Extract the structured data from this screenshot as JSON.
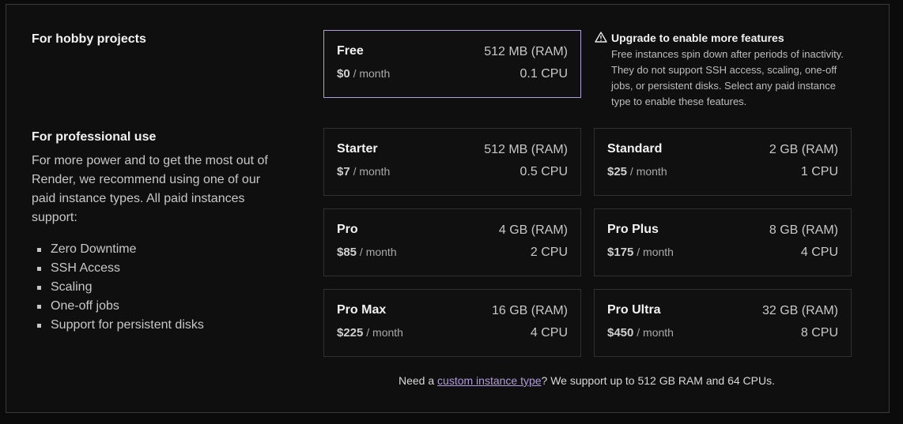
{
  "hobby": {
    "title": "For hobby projects"
  },
  "professional": {
    "title": "For professional use",
    "description": "For more power and to get the most out of Render, we recommend using one of our paid instance types. All paid instances support:",
    "features": [
      "Zero Downtime",
      "SSH Access",
      "Scaling",
      "One-off jobs",
      "Support for persistent disks"
    ]
  },
  "warning": {
    "icon": "warning-triangle-icon",
    "title": "Upgrade to enable more features",
    "body": "Free instances spin down after periods of inactivity. They do not support SSH access, scaling, one-off jobs, or persistent disks. Select any paid instance type to enable these features."
  },
  "instances": {
    "free": {
      "name": "Free",
      "amount": "$0",
      "period": "/ month",
      "ram": "512 MB (RAM)",
      "cpu": "0.1 CPU",
      "selected": true
    },
    "starter": {
      "name": "Starter",
      "amount": "$7",
      "period": "/ month",
      "ram": "512 MB (RAM)",
      "cpu": "0.5 CPU"
    },
    "standard": {
      "name": "Standard",
      "amount": "$25",
      "period": "/ month",
      "ram": "2 GB (RAM)",
      "cpu": "1 CPU"
    },
    "pro": {
      "name": "Pro",
      "amount": "$85",
      "period": "/ month",
      "ram": "4 GB (RAM)",
      "cpu": "2 CPU"
    },
    "pro_plus": {
      "name": "Pro Plus",
      "amount": "$175",
      "period": "/ month",
      "ram": "8 GB (RAM)",
      "cpu": "4 CPU"
    },
    "pro_max": {
      "name": "Pro Max",
      "amount": "$225",
      "period": "/ month",
      "ram": "16 GB (RAM)",
      "cpu": "4 CPU"
    },
    "pro_ultra": {
      "name": "Pro Ultra",
      "amount": "$450",
      "period": "/ month",
      "ram": "32 GB (RAM)",
      "cpu": "8 CPU"
    }
  },
  "footer": {
    "prefix": "Need a ",
    "link": "custom instance type",
    "suffix": "? We support up to 512 GB RAM and 64 CPUs."
  },
  "colors": {
    "background": "#0b0b0b",
    "selected_border": "#b39ddb",
    "link": "#b39ddb"
  }
}
